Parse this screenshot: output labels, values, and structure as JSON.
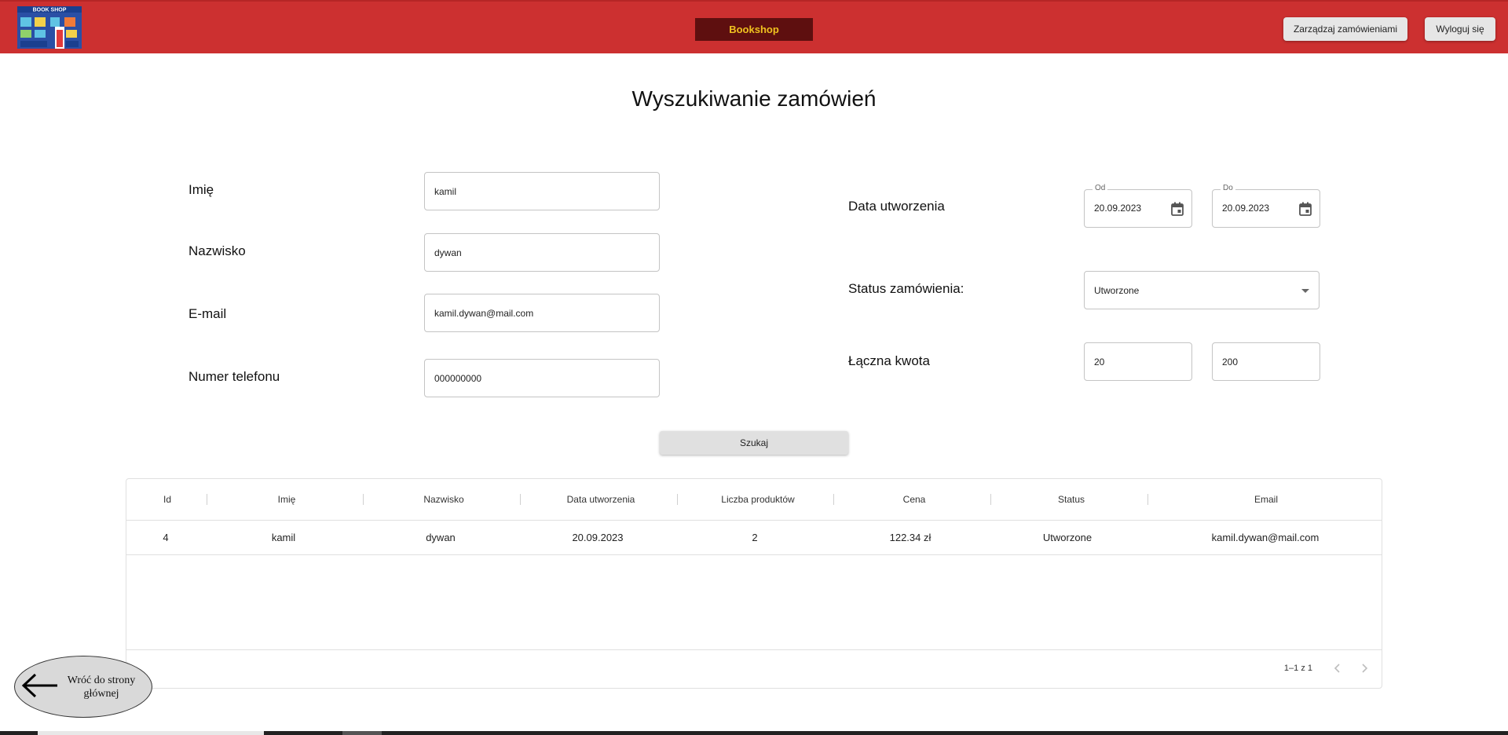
{
  "header": {
    "logo_icon": "bookshop-storefront-icon",
    "logo_text": "BOOK SHOP",
    "brand": "Bookshop",
    "manage_orders": "Zarządzaj zamówieniami",
    "logout": "Wyloguj się",
    "colors": {
      "bar": "#cc3030",
      "brand_bg": "#5e0f0f",
      "brand_text": "#f0c21f"
    }
  },
  "page": {
    "title": "Wyszukiwanie zamówień"
  },
  "form": {
    "first_name": {
      "label": "Imię",
      "value": "kamil"
    },
    "last_name": {
      "label": "Nazwisko",
      "value": "dywan"
    },
    "email": {
      "label": "E-mail",
      "value": "kamil.dywan@mail.com"
    },
    "phone": {
      "label": "Numer telefonu",
      "value": "000000000"
    },
    "created": {
      "label": "Data utworzenia",
      "from_label": "Od",
      "from_value": "20.09.2023",
      "to_label": "Do",
      "to_value": "20.09.2023"
    },
    "status": {
      "label": "Status zamówienia:",
      "value": "Utworzone"
    },
    "total": {
      "label": "Łączna kwota",
      "min": "20",
      "max": "200"
    },
    "search_button": "Szukaj"
  },
  "table": {
    "columns": [
      "Id",
      "Imię",
      "Nazwisko",
      "Data utworzenia",
      "Liczba produktów",
      "Cena",
      "Status",
      "Email"
    ],
    "rows": [
      [
        "4",
        "kamil",
        "dywan",
        "20.09.2023",
        "2",
        "122.34 zł",
        "Utworzone",
        "kamil.dywan@mail.com"
      ]
    ],
    "pagination": "1–1 z 1"
  },
  "back": {
    "line1": "Wróć do strony",
    "line2": "głównej",
    "icon": "arrow-left-icon"
  }
}
